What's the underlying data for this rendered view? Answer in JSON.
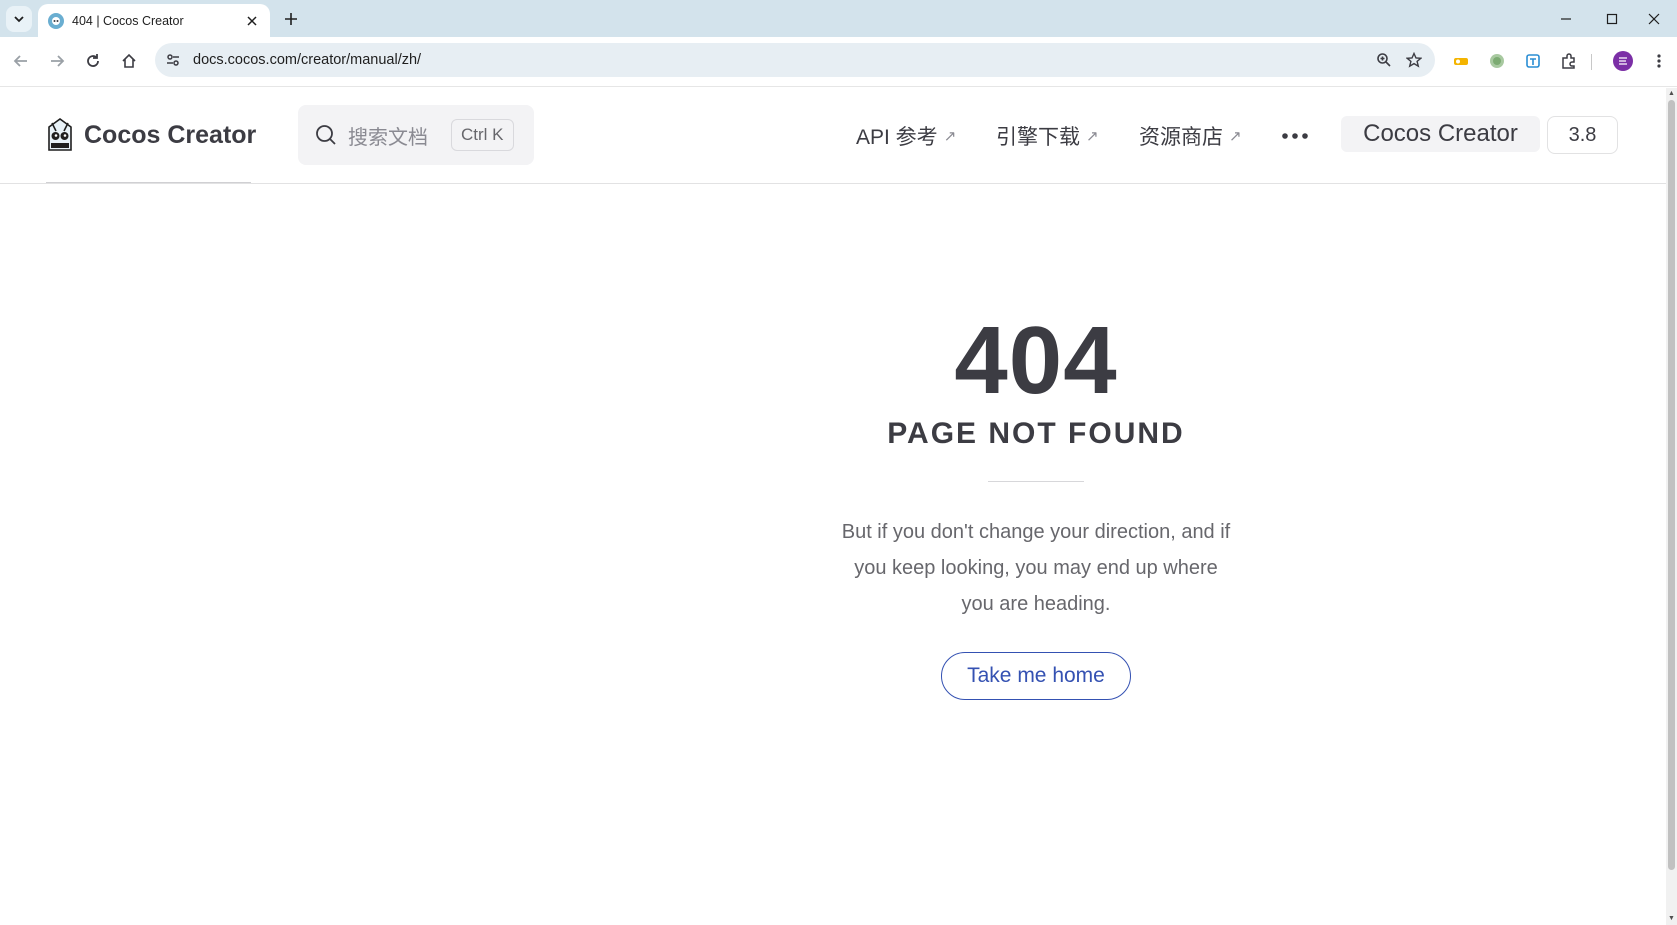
{
  "browser": {
    "tab_title": "404 | Cocos Creator",
    "url": "docs.cocos.com/creator/manual/zh/"
  },
  "site": {
    "logo_text": "Cocos Creator",
    "search": {
      "placeholder": "搜索文档",
      "shortcut": "Ctrl K"
    },
    "nav": [
      {
        "label": "API 参考",
        "arrow": "↗"
      },
      {
        "label": "引擎下载",
        "arrow": "↗"
      },
      {
        "label": "资源商店",
        "arrow": "↗"
      }
    ],
    "product": "Cocos Creator",
    "version": "3.8"
  },
  "notfound": {
    "code": "404",
    "title": "PAGE NOT FOUND",
    "quote": "But if you don't change your direction, and if you keep looking, you may end up where you are heading.",
    "button": "Take me home"
  },
  "colors": {
    "brand": "#3451b2",
    "text": "#3c3c43",
    "muted": "#67676c",
    "chrome": "#d3e3ec"
  }
}
